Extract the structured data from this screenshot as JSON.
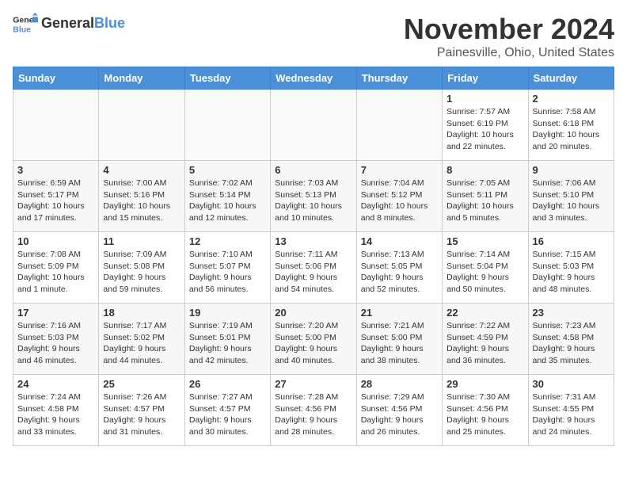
{
  "header": {
    "logo_general": "General",
    "logo_blue": "Blue",
    "month_title": "November 2024",
    "location": "Painesville, Ohio, United States"
  },
  "weekdays": [
    "Sunday",
    "Monday",
    "Tuesday",
    "Wednesday",
    "Thursday",
    "Friday",
    "Saturday"
  ],
  "weeks": [
    [
      {
        "day": "",
        "info": ""
      },
      {
        "day": "",
        "info": ""
      },
      {
        "day": "",
        "info": ""
      },
      {
        "day": "",
        "info": ""
      },
      {
        "day": "",
        "info": ""
      },
      {
        "day": "1",
        "info": "Sunrise: 7:57 AM\nSunset: 6:19 PM\nDaylight: 10 hours and 22 minutes."
      },
      {
        "day": "2",
        "info": "Sunrise: 7:58 AM\nSunset: 6:18 PM\nDaylight: 10 hours and 20 minutes."
      }
    ],
    [
      {
        "day": "3",
        "info": "Sunrise: 6:59 AM\nSunset: 5:17 PM\nDaylight: 10 hours and 17 minutes."
      },
      {
        "day": "4",
        "info": "Sunrise: 7:00 AM\nSunset: 5:16 PM\nDaylight: 10 hours and 15 minutes."
      },
      {
        "day": "5",
        "info": "Sunrise: 7:02 AM\nSunset: 5:14 PM\nDaylight: 10 hours and 12 minutes."
      },
      {
        "day": "6",
        "info": "Sunrise: 7:03 AM\nSunset: 5:13 PM\nDaylight: 10 hours and 10 minutes."
      },
      {
        "day": "7",
        "info": "Sunrise: 7:04 AM\nSunset: 5:12 PM\nDaylight: 10 hours and 8 minutes."
      },
      {
        "day": "8",
        "info": "Sunrise: 7:05 AM\nSunset: 5:11 PM\nDaylight: 10 hours and 5 minutes."
      },
      {
        "day": "9",
        "info": "Sunrise: 7:06 AM\nSunset: 5:10 PM\nDaylight: 10 hours and 3 minutes."
      }
    ],
    [
      {
        "day": "10",
        "info": "Sunrise: 7:08 AM\nSunset: 5:09 PM\nDaylight: 10 hours and 1 minute."
      },
      {
        "day": "11",
        "info": "Sunrise: 7:09 AM\nSunset: 5:08 PM\nDaylight: 9 hours and 59 minutes."
      },
      {
        "day": "12",
        "info": "Sunrise: 7:10 AM\nSunset: 5:07 PM\nDaylight: 9 hours and 56 minutes."
      },
      {
        "day": "13",
        "info": "Sunrise: 7:11 AM\nSunset: 5:06 PM\nDaylight: 9 hours and 54 minutes."
      },
      {
        "day": "14",
        "info": "Sunrise: 7:13 AM\nSunset: 5:05 PM\nDaylight: 9 hours and 52 minutes."
      },
      {
        "day": "15",
        "info": "Sunrise: 7:14 AM\nSunset: 5:04 PM\nDaylight: 9 hours and 50 minutes."
      },
      {
        "day": "16",
        "info": "Sunrise: 7:15 AM\nSunset: 5:03 PM\nDaylight: 9 hours and 48 minutes."
      }
    ],
    [
      {
        "day": "17",
        "info": "Sunrise: 7:16 AM\nSunset: 5:03 PM\nDaylight: 9 hours and 46 minutes."
      },
      {
        "day": "18",
        "info": "Sunrise: 7:17 AM\nSunset: 5:02 PM\nDaylight: 9 hours and 44 minutes."
      },
      {
        "day": "19",
        "info": "Sunrise: 7:19 AM\nSunset: 5:01 PM\nDaylight: 9 hours and 42 minutes."
      },
      {
        "day": "20",
        "info": "Sunrise: 7:20 AM\nSunset: 5:00 PM\nDaylight: 9 hours and 40 minutes."
      },
      {
        "day": "21",
        "info": "Sunrise: 7:21 AM\nSunset: 5:00 PM\nDaylight: 9 hours and 38 minutes."
      },
      {
        "day": "22",
        "info": "Sunrise: 7:22 AM\nSunset: 4:59 PM\nDaylight: 9 hours and 36 minutes."
      },
      {
        "day": "23",
        "info": "Sunrise: 7:23 AM\nSunset: 4:58 PM\nDaylight: 9 hours and 35 minutes."
      }
    ],
    [
      {
        "day": "24",
        "info": "Sunrise: 7:24 AM\nSunset: 4:58 PM\nDaylight: 9 hours and 33 minutes."
      },
      {
        "day": "25",
        "info": "Sunrise: 7:26 AM\nSunset: 4:57 PM\nDaylight: 9 hours and 31 minutes."
      },
      {
        "day": "26",
        "info": "Sunrise: 7:27 AM\nSunset: 4:57 PM\nDaylight: 9 hours and 30 minutes."
      },
      {
        "day": "27",
        "info": "Sunrise: 7:28 AM\nSunset: 4:56 PM\nDaylight: 9 hours and 28 minutes."
      },
      {
        "day": "28",
        "info": "Sunrise: 7:29 AM\nSunset: 4:56 PM\nDaylight: 9 hours and 26 minutes."
      },
      {
        "day": "29",
        "info": "Sunrise: 7:30 AM\nSunset: 4:56 PM\nDaylight: 9 hours and 25 minutes."
      },
      {
        "day": "30",
        "info": "Sunrise: 7:31 AM\nSunset: 4:55 PM\nDaylight: 9 hours and 24 minutes."
      }
    ]
  ]
}
